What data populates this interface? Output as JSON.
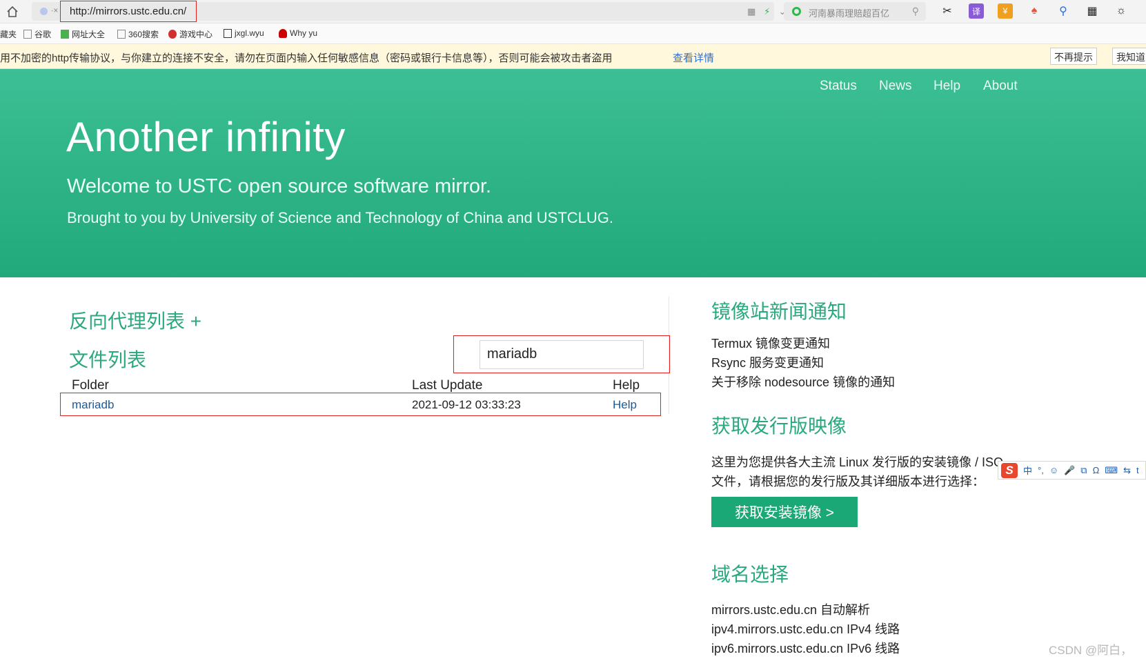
{
  "browser": {
    "url": "http://mirrors.ustc.edu.cn/",
    "addr_prefix": "🔒",
    "search_placeholder": "河南暴雨理赔超百亿",
    "bookmarks": [
      "藏夹",
      "谷歌",
      "网址大全",
      "360搜索",
      "游戏中心",
      "jxgl.wyu",
      "Why yu"
    ],
    "warning": {
      "text": "用不加密的http传输协议，与你建立的连接不安全，请勿在页面内输入任何敏感信息（密码或银行卡信息等），否则可能会被攻击者盗用",
      "link": "查看详情",
      "btn_no_remind": "不再提示",
      "btn_ok": "我知道"
    }
  },
  "hero": {
    "nav": [
      "Status",
      "News",
      "Help",
      "About"
    ],
    "title": "Another infinity",
    "subtitle": "Welcome to USTC open source software mirror.",
    "byline": "Brought to you by University of Science and Technology of China and USTCLUG."
  },
  "left": {
    "proxy_title": "反向代理列表 +",
    "files_title": "文件列表",
    "search_value": "mariadb",
    "columns": [
      "Folder",
      "Last Update",
      "Help"
    ],
    "rows": [
      {
        "folder": "mariadb",
        "updated": "2021-09-12 03:33:23",
        "help": "Help"
      }
    ]
  },
  "right": {
    "news_title": "镜像站新闻通知",
    "news": [
      "Termux 镜像变更通知",
      "Rsync 服务变更通知",
      "关于移除 nodesource 镜像的通知"
    ],
    "iso_title": "获取发行版映像",
    "iso_text_1": "这里为您提供各大主流 Linux 发行版的安装镜像 / ISO",
    "iso_text_2": "文件，请根据您的发行版及其详细版本进行选择：",
    "iso_button": "获取安装镜像 >",
    "domain_title": "域名选择",
    "domains": [
      "mirrors.ustc.edu.cn 自动解析",
      "ipv4.mirrors.ustc.edu.cn IPv4 线路",
      "ipv6.mirrors.ustc.edu.cn IPv6 线路"
    ]
  },
  "ime": {
    "logo": "S",
    "items": [
      "中",
      "°,",
      "☺",
      "🎤",
      "⧉",
      "Ω",
      "⌨",
      "⇆",
      "t"
    ]
  },
  "watermark": "CSDN @阿白，"
}
